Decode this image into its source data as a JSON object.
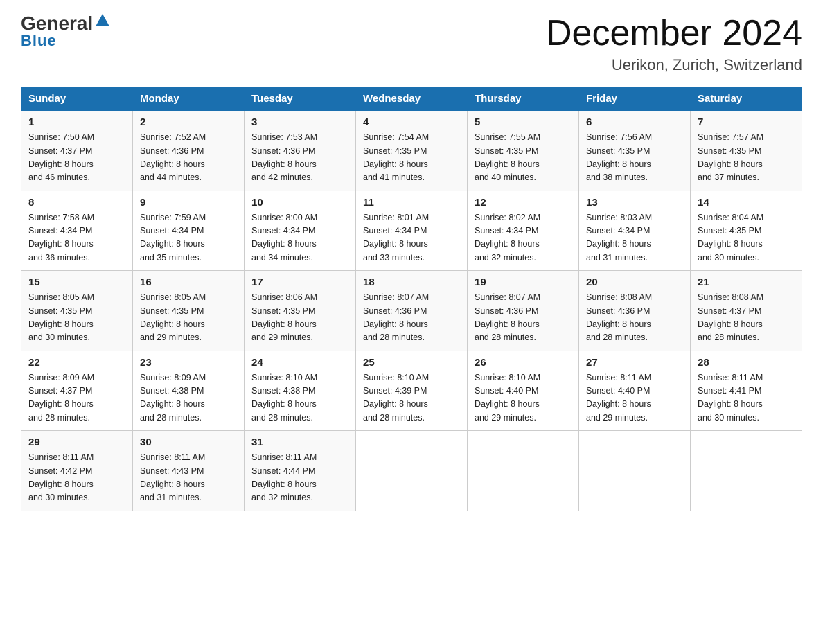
{
  "logo": {
    "general": "General",
    "blue": "Blue"
  },
  "header": {
    "month": "December 2024",
    "location": "Uerikon, Zurich, Switzerland"
  },
  "days_of_week": [
    "Sunday",
    "Monday",
    "Tuesday",
    "Wednesday",
    "Thursday",
    "Friday",
    "Saturday"
  ],
  "weeks": [
    [
      {
        "day": "1",
        "sunrise": "7:50 AM",
        "sunset": "4:37 PM",
        "daylight": "8 hours and 46 minutes."
      },
      {
        "day": "2",
        "sunrise": "7:52 AM",
        "sunset": "4:36 PM",
        "daylight": "8 hours and 44 minutes."
      },
      {
        "day": "3",
        "sunrise": "7:53 AM",
        "sunset": "4:36 PM",
        "daylight": "8 hours and 42 minutes."
      },
      {
        "day": "4",
        "sunrise": "7:54 AM",
        "sunset": "4:35 PM",
        "daylight": "8 hours and 41 minutes."
      },
      {
        "day": "5",
        "sunrise": "7:55 AM",
        "sunset": "4:35 PM",
        "daylight": "8 hours and 40 minutes."
      },
      {
        "day": "6",
        "sunrise": "7:56 AM",
        "sunset": "4:35 PM",
        "daylight": "8 hours and 38 minutes."
      },
      {
        "day": "7",
        "sunrise": "7:57 AM",
        "sunset": "4:35 PM",
        "daylight": "8 hours and 37 minutes."
      }
    ],
    [
      {
        "day": "8",
        "sunrise": "7:58 AM",
        "sunset": "4:34 PM",
        "daylight": "8 hours and 36 minutes."
      },
      {
        "day": "9",
        "sunrise": "7:59 AM",
        "sunset": "4:34 PM",
        "daylight": "8 hours and 35 minutes."
      },
      {
        "day": "10",
        "sunrise": "8:00 AM",
        "sunset": "4:34 PM",
        "daylight": "8 hours and 34 minutes."
      },
      {
        "day": "11",
        "sunrise": "8:01 AM",
        "sunset": "4:34 PM",
        "daylight": "8 hours and 33 minutes."
      },
      {
        "day": "12",
        "sunrise": "8:02 AM",
        "sunset": "4:34 PM",
        "daylight": "8 hours and 32 minutes."
      },
      {
        "day": "13",
        "sunrise": "8:03 AM",
        "sunset": "4:34 PM",
        "daylight": "8 hours and 31 minutes."
      },
      {
        "day": "14",
        "sunrise": "8:04 AM",
        "sunset": "4:35 PM",
        "daylight": "8 hours and 30 minutes."
      }
    ],
    [
      {
        "day": "15",
        "sunrise": "8:05 AM",
        "sunset": "4:35 PM",
        "daylight": "8 hours and 30 minutes."
      },
      {
        "day": "16",
        "sunrise": "8:05 AM",
        "sunset": "4:35 PM",
        "daylight": "8 hours and 29 minutes."
      },
      {
        "day": "17",
        "sunrise": "8:06 AM",
        "sunset": "4:35 PM",
        "daylight": "8 hours and 29 minutes."
      },
      {
        "day": "18",
        "sunrise": "8:07 AM",
        "sunset": "4:36 PM",
        "daylight": "8 hours and 28 minutes."
      },
      {
        "day": "19",
        "sunrise": "8:07 AM",
        "sunset": "4:36 PM",
        "daylight": "8 hours and 28 minutes."
      },
      {
        "day": "20",
        "sunrise": "8:08 AM",
        "sunset": "4:36 PM",
        "daylight": "8 hours and 28 minutes."
      },
      {
        "day": "21",
        "sunrise": "8:08 AM",
        "sunset": "4:37 PM",
        "daylight": "8 hours and 28 minutes."
      }
    ],
    [
      {
        "day": "22",
        "sunrise": "8:09 AM",
        "sunset": "4:37 PM",
        "daylight": "8 hours and 28 minutes."
      },
      {
        "day": "23",
        "sunrise": "8:09 AM",
        "sunset": "4:38 PM",
        "daylight": "8 hours and 28 minutes."
      },
      {
        "day": "24",
        "sunrise": "8:10 AM",
        "sunset": "4:38 PM",
        "daylight": "8 hours and 28 minutes."
      },
      {
        "day": "25",
        "sunrise": "8:10 AM",
        "sunset": "4:39 PM",
        "daylight": "8 hours and 28 minutes."
      },
      {
        "day": "26",
        "sunrise": "8:10 AM",
        "sunset": "4:40 PM",
        "daylight": "8 hours and 29 minutes."
      },
      {
        "day": "27",
        "sunrise": "8:11 AM",
        "sunset": "4:40 PM",
        "daylight": "8 hours and 29 minutes."
      },
      {
        "day": "28",
        "sunrise": "8:11 AM",
        "sunset": "4:41 PM",
        "daylight": "8 hours and 30 minutes."
      }
    ],
    [
      {
        "day": "29",
        "sunrise": "8:11 AM",
        "sunset": "4:42 PM",
        "daylight": "8 hours and 30 minutes."
      },
      {
        "day": "30",
        "sunrise": "8:11 AM",
        "sunset": "4:43 PM",
        "daylight": "8 hours and 31 minutes."
      },
      {
        "day": "31",
        "sunrise": "8:11 AM",
        "sunset": "4:44 PM",
        "daylight": "8 hours and 32 minutes."
      },
      null,
      null,
      null,
      null
    ]
  ],
  "labels": {
    "sunrise": "Sunrise:",
    "sunset": "Sunset:",
    "daylight": "Daylight:"
  }
}
